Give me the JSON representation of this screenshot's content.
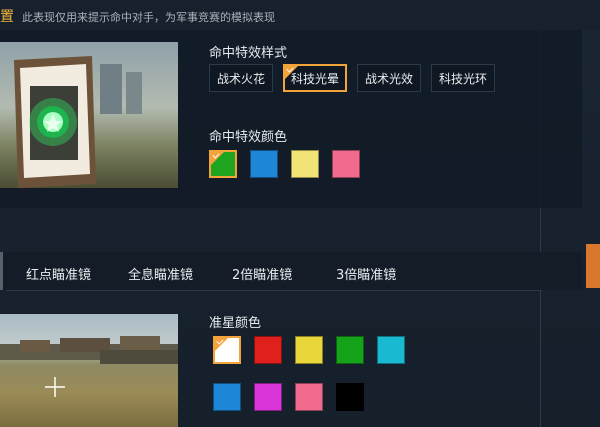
{
  "header": {
    "title_fragment": "置",
    "description": "此表现仅用来提示命中对手，为军事竞赛的模拟表现"
  },
  "hit_effect_style": {
    "label": "命中特效样式",
    "options": [
      "战术火花",
      "科技光晕",
      "战术光效",
      "科技光环"
    ],
    "selected_index": 1
  },
  "hit_effect_color": {
    "label": "命中特效颜色",
    "colors": [
      "#1fa51f",
      "#1e86d6",
      "#f1e376",
      "#f06b8e"
    ],
    "selected_index": 0
  },
  "scope_tabs": [
    "红点瞄准镜",
    "全息瞄准镜",
    "2倍瞄准镜",
    "3倍瞄准镜"
  ],
  "crosshair_color": {
    "label": "准星颜色",
    "colors": [
      "#ffffff",
      "#e0201c",
      "#e8d63a",
      "#15a31a",
      "#18b9d1",
      "#1e86d6",
      "#d935d9",
      "#f06b8e",
      "#000000"
    ],
    "selected_index": 0
  }
}
